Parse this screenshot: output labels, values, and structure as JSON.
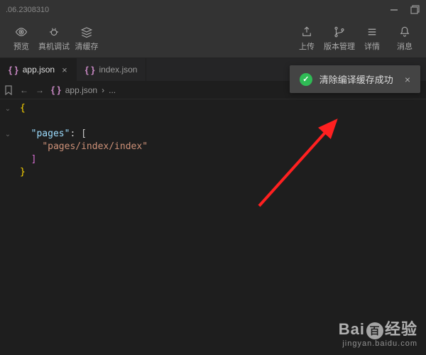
{
  "titlebar": {
    "version": ".06.2308310"
  },
  "toolbar": {
    "left": {
      "preview": "预览",
      "debug": "真机调试",
      "clear": "清缓存"
    },
    "right": {
      "upload": "上传",
      "version": "版本管理",
      "details": "详情",
      "message": "消息"
    }
  },
  "tabs": {
    "active": "app.json",
    "other": "index.json"
  },
  "breadcrumb": {
    "file": "app.json",
    "sep": "›",
    "more": "..."
  },
  "code": {
    "l1": "{",
    "l2_key": "\"pages\"",
    "l2_colon": ": [",
    "l3": "\"pages/index/index\"",
    "l4": "]",
    "l5": "}"
  },
  "notification": {
    "text": "清除编译缓存成功"
  },
  "watermark": {
    "brand_pre": "Bai",
    "brand_mid": "百",
    "brand_post": "经验",
    "url": "jingyan.baidu.com"
  }
}
